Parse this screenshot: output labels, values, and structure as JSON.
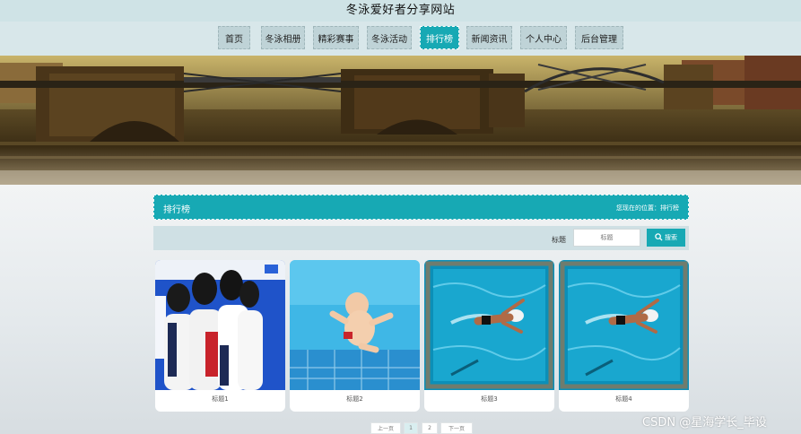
{
  "site": {
    "title": "冬泳爱好者分享网站"
  },
  "nav": {
    "items": [
      {
        "label": "首页"
      },
      {
        "label": "冬泳相册"
      },
      {
        "label": "精彩赛事"
      },
      {
        "label": "冬泳活动"
      },
      {
        "label": "排行榜"
      },
      {
        "label": "新闻资讯"
      },
      {
        "label": "个人中心"
      },
      {
        "label": "后台管理"
      }
    ],
    "active": "排行榜"
  },
  "section": {
    "title": "排行榜",
    "location": "您现在的位置：排行榜"
  },
  "search": {
    "label": "标题",
    "placeholder": "标题",
    "button_label": "搜索"
  },
  "cards": [
    {
      "caption": "标题1"
    },
    {
      "caption": "标题2"
    },
    {
      "caption": "标题3"
    },
    {
      "caption": "标题4"
    }
  ],
  "pagination": {
    "prev": "上一页",
    "pages": [
      "1",
      "2"
    ],
    "current": "1",
    "next": "下一页"
  },
  "watermark": "CSDN @星海学长_毕设",
  "colors": {
    "accent": "#17a9b4",
    "nav_bg": "#d8e7ea",
    "nav_item": "#bfd3d7"
  }
}
